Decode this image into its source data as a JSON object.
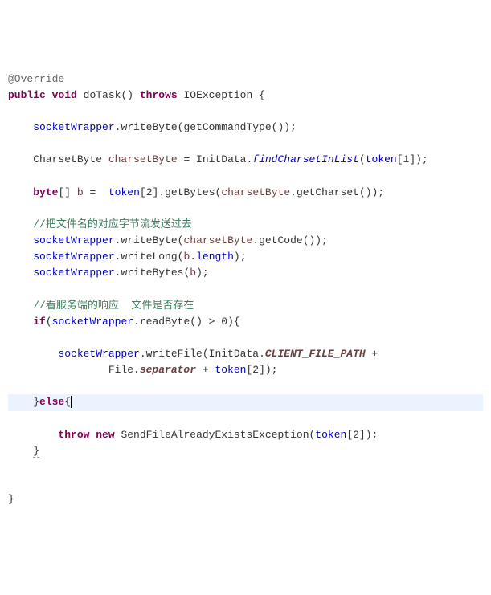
{
  "line1_ann": "@Override",
  "line2": {
    "kw1": "public",
    "kw2": "void",
    "method": "doTask",
    "kw3": "throws",
    "ex": "IOException"
  },
  "line4": {
    "field": "socketWrapper",
    "m1": "writeByte",
    "m2": "getCommandType"
  },
  "line6": {
    "t": "CharsetByte",
    "v": "charsetByte",
    "cls": "InitData",
    "m": "findCharsetInList",
    "arr": "token",
    "idx": "1"
  },
  "line8": {
    "kw": "byte",
    "v": "b",
    "arr": "token",
    "idx": "2",
    "m": "getBytes",
    "cv": "charsetByte",
    "cm": "getCharset"
  },
  "line10_comment": "//把文件名的对应字节流发送过去",
  "line11": {
    "field": "socketWrapper",
    "m": "writeByte",
    "v": "charsetByte",
    "vm": "getCode"
  },
  "line12": {
    "field": "socketWrapper",
    "m": "writeLong",
    "v": "b",
    "p": "length"
  },
  "line13": {
    "field": "socketWrapper",
    "m": "writeBytes",
    "v": "b"
  },
  "line15_comment": "//看服务端的响应  文件是否存在",
  "line16": {
    "kw": "if",
    "field": "socketWrapper",
    "m": "readByte",
    "op": ">",
    "n": "0"
  },
  "line18": {
    "field": "socketWrapper",
    "m": "writeFile",
    "cls": "InitData",
    "const": "CLIENT_FILE_PATH"
  },
  "line19": {
    "cls": "File",
    "const": "separator",
    "arr": "token",
    "idx": "2"
  },
  "line21": {
    "kw": "else"
  },
  "line23": {
    "kw1": "throw",
    "kw2": "new",
    "ex": "SendFileAlreadyExistsException",
    "arr": "token",
    "idx": "2"
  }
}
